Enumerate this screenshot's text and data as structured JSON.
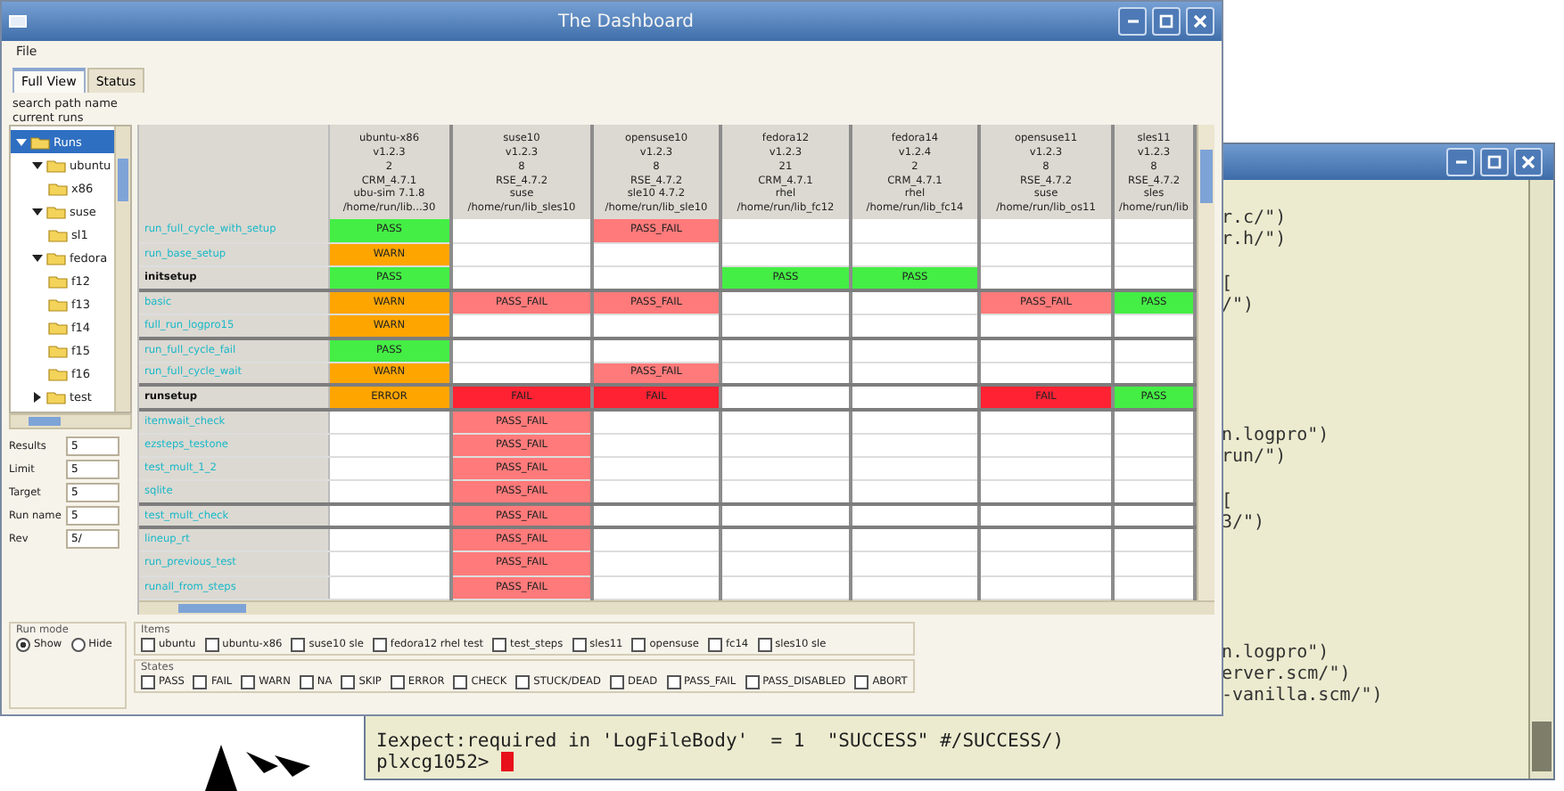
{
  "terminal": {
    "lines": [
      {
        "kind": "clipped",
        "text": "r.c/\")"
      },
      {
        "kind": "clipped",
        "text": "r.h/\")"
      },
      {
        "kind": "blank"
      },
      {
        "kind": "clipped",
        "text": "["
      },
      {
        "kind": "clipped",
        "text": "/\")"
      },
      {
        "kind": "blank"
      },
      {
        "kind": "blank"
      },
      {
        "kind": "blank"
      },
      {
        "kind": "blank"
      },
      {
        "kind": "blank"
      },
      {
        "kind": "clipped",
        "text": "n.logpro\")"
      },
      {
        "kind": "clipped",
        "text": "run/\")"
      },
      {
        "kind": "blank"
      },
      {
        "kind": "clipped",
        "text": "["
      },
      {
        "kind": "clipped",
        "text": "3/\")"
      },
      {
        "kind": "blank"
      },
      {
        "kind": "blank"
      },
      {
        "kind": "blank"
      },
      {
        "kind": "blank"
      },
      {
        "kind": "blank"
      },
      {
        "kind": "clipped",
        "text": "n.logpro\")"
      },
      {
        "kind": "clipped",
        "text": "erver.scm/\")"
      },
      {
        "kind": "clipped",
        "text": "-vanilla.scm/\")"
      },
      {
        "kind": "blank"
      },
      {
        "kind": "full",
        "text": "Iexpect:required in 'LogFileBody'  = 1  \"SUCCESS\" #/SUCCESS/)"
      },
      {
        "kind": "prompt",
        "text": "plxcg1052> "
      }
    ]
  },
  "dashboard": {
    "title": "The Dashboard",
    "menu": [
      "File"
    ],
    "tabs": [
      {
        "label": "Full View",
        "selected": true
      },
      {
        "label": "Status",
        "selected": false
      }
    ],
    "info": [
      "search path name",
      "current   runs"
    ],
    "tree": [
      {
        "label": "Runs",
        "selected": true,
        "expanded": true,
        "children": [
          {
            "label": "ubuntu",
            "selected": false,
            "expanded": true,
            "children": [
              {
                "label": "x86",
                "selected": false
              }
            ]
          },
          {
            "label": "suse",
            "selected": false,
            "expanded": true,
            "children": [
              {
                "label": "sl1",
                "selected": false
              }
            ]
          },
          {
            "label": "fedora",
            "selected": false,
            "expanded": true,
            "children": [
              {
                "label": "f12",
                "selected": false
              },
              {
                "label": "f13",
                "selected": false
              },
              {
                "label": "f14",
                "selected": false
              },
              {
                "label": "f15",
                "selected": false
              },
              {
                "label": "f16",
                "selected": false
              }
            ]
          },
          {
            "label": "test",
            "selected": false,
            "expanded": false
          }
        ]
      }
    ],
    "fields": [
      {
        "label": "Results",
        "value": "5"
      },
      {
        "label": "Limit",
        "value": "5"
      },
      {
        "label": "Target",
        "value": "5"
      },
      {
        "label": "Run name",
        "value": "5"
      },
      {
        "label": "Rev",
        "value": "5/"
      }
    ],
    "table": {
      "columns": [
        {
          "lines": [
            "ubuntu-x86",
            "v1.2.3",
            "2",
            "CRM_4.7.1",
            "ubu-sim 7.1.8",
            "/home/run/lib...30"
          ]
        },
        {
          "lines": [
            "suse10",
            "v1.2.3",
            "8",
            "RSE_4.7.2",
            "suse",
            "/home/run/lib_sles10"
          ]
        },
        {
          "lines": [
            "opensuse10",
            "v1.2.3",
            "8",
            "RSE_4.7.2",
            "sle10 4.7.2",
            "/home/run/lib_sle10"
          ]
        },
        {
          "lines": [
            "fedora12",
            "v1.2.3",
            "21",
            "CRM_4.7.1",
            "rhel",
            "/home/run/lib_fc12"
          ]
        },
        {
          "lines": [
            "fedora14",
            "v1.2.4",
            "2",
            "CRM_4.7.1",
            "rhel",
            "/home/run/lib_fc14"
          ]
        },
        {
          "lines": [
            "opensuse11",
            "v1.2.3",
            "8",
            "RSE_4.7.2",
            "suse",
            "/home/run/lib_os11"
          ]
        },
        {
          "lines": [
            "sles11",
            "v1.2.3",
            "8",
            "RSE_4.7.2",
            "sles",
            "/home/run/lib"
          ]
        }
      ],
      "rows": [
        {
          "label": "run_full_cycle_with_setup",
          "kind": "test",
          "cells": [
            {
              "kind": "pass",
              "text": "PASS"
            },
            {
              "kind": "empty"
            },
            {
              "kind": "pass_fail",
              "text": "PASS_FAIL"
            },
            {
              "kind": "empty"
            },
            {
              "kind": "empty"
            },
            {
              "kind": "empty"
            },
            {
              "kind": "empty"
            }
          ]
        },
        {
          "label": "run_base_setup",
          "kind": "test",
          "cells": [
            {
              "kind": "warn",
              "text": "WARN"
            },
            {
              "kind": "empty"
            },
            {
              "kind": "empty"
            },
            {
              "kind": "empty"
            },
            {
              "kind": "empty"
            },
            {
              "kind": "empty"
            },
            {
              "kind": "empty"
            }
          ]
        },
        {
          "label": "initsetup",
          "kind": "group",
          "cells": [
            {
              "kind": "pass",
              "text": "PASS"
            },
            {
              "kind": "empty"
            },
            {
              "kind": "empty"
            },
            {
              "kind": "pass",
              "text": "PASS"
            },
            {
              "kind": "pass",
              "text": "PASS"
            },
            {
              "kind": "empty"
            },
            {
              "kind": "empty"
            }
          ]
        },
        {
          "label": "basic",
          "kind": "test",
          "cells": [
            {
              "kind": "warn",
              "text": "WARN"
            },
            {
              "kind": "pass_fail",
              "text": "PASS_FAIL"
            },
            {
              "kind": "pass_fail",
              "text": "PASS_FAIL"
            },
            {
              "kind": "empty"
            },
            {
              "kind": "empty"
            },
            {
              "kind": "pass_fail",
              "text": "PASS_FAIL"
            },
            {
              "kind": "pass",
              "text": "PASS"
            }
          ]
        },
        {
          "label": "full_run_logpro15",
          "kind": "test",
          "cells": [
            {
              "kind": "warn",
              "text": "WARN"
            },
            {
              "kind": "empty"
            },
            {
              "kind": "empty"
            },
            {
              "kind": "empty"
            },
            {
              "kind": "empty"
            },
            {
              "kind": "empty"
            },
            {
              "kind": "empty"
            }
          ]
        },
        {
          "label": "run_full_cycle_fail",
          "kind": "test",
          "cells": [
            {
              "kind": "pass",
              "text": "PASS"
            },
            {
              "kind": "empty"
            },
            {
              "kind": "empty"
            },
            {
              "kind": "empty"
            },
            {
              "kind": "empty"
            },
            {
              "kind": "empty"
            },
            {
              "kind": "empty"
            }
          ]
        },
        {
          "label": "run_full_cycle_wait",
          "kind": "test",
          "cells": [
            {
              "kind": "warn",
              "text": "WARN"
            },
            {
              "kind": "empty"
            },
            {
              "kind": "pass_fail",
              "text": "PASS_FAIL"
            },
            {
              "kind": "empty"
            },
            {
              "kind": "empty"
            },
            {
              "kind": "empty"
            },
            {
              "kind": "empty"
            }
          ]
        },
        {
          "label": "runsetup",
          "kind": "group",
          "cells": [
            {
              "kind": "error",
              "text": "ERROR"
            },
            {
              "kind": "fail",
              "text": "FAIL"
            },
            {
              "kind": "fail",
              "text": "FAIL"
            },
            {
              "kind": "empty"
            },
            {
              "kind": "empty"
            },
            {
              "kind": "fail",
              "text": "FAIL"
            },
            {
              "kind": "pass",
              "text": "PASS"
            }
          ]
        },
        {
          "label": "itemwait_check",
          "kind": "test",
          "cells": [
            {
              "kind": "empty"
            },
            {
              "kind": "pass_fail",
              "text": "PASS_FAIL"
            },
            {
              "kind": "empty"
            },
            {
              "kind": "empty"
            },
            {
              "kind": "empty"
            },
            {
              "kind": "empty"
            },
            {
              "kind": "empty"
            }
          ]
        },
        {
          "label": "ezsteps_testone",
          "kind": "test",
          "cells": [
            {
              "kind": "empty"
            },
            {
              "kind": "pass_fail",
              "text": "PASS_FAIL"
            },
            {
              "kind": "empty"
            },
            {
              "kind": "empty"
            },
            {
              "kind": "empty"
            },
            {
              "kind": "empty"
            },
            {
              "kind": "empty"
            }
          ]
        },
        {
          "label": "test_mult_1_2",
          "kind": "test",
          "cells": [
            {
              "kind": "empty"
            },
            {
              "kind": "pass_fail",
              "text": "PASS_FAIL"
            },
            {
              "kind": "empty"
            },
            {
              "kind": "empty"
            },
            {
              "kind": "empty"
            },
            {
              "kind": "empty"
            },
            {
              "kind": "empty"
            }
          ]
        },
        {
          "label": "sqlite",
          "kind": "test",
          "cells": [
            {
              "kind": "empty"
            },
            {
              "kind": "pass_fail",
              "text": "PASS_FAIL"
            },
            {
              "kind": "empty"
            },
            {
              "kind": "empty"
            },
            {
              "kind": "empty"
            },
            {
              "kind": "empty"
            },
            {
              "kind": "empty"
            }
          ]
        },
        {
          "label": "test_mult_check",
          "kind": "test",
          "cells": [
            {
              "kind": "empty"
            },
            {
              "kind": "pass_fail",
              "text": "PASS_FAIL"
            },
            {
              "kind": "empty"
            },
            {
              "kind": "empty"
            },
            {
              "kind": "empty"
            },
            {
              "kind": "empty"
            },
            {
              "kind": "empty"
            }
          ]
        },
        {
          "label": "lineup_rt",
          "kind": "test",
          "cells": [
            {
              "kind": "empty"
            },
            {
              "kind": "pass_fail",
              "text": "PASS_FAIL"
            },
            {
              "kind": "empty"
            },
            {
              "kind": "empty"
            },
            {
              "kind": "empty"
            },
            {
              "kind": "empty"
            },
            {
              "kind": "empty"
            }
          ]
        },
        {
          "label": "run_previous_test",
          "kind": "test",
          "cells": [
            {
              "kind": "empty"
            },
            {
              "kind": "pass_fail",
              "text": "PASS_FAIL"
            },
            {
              "kind": "empty"
            },
            {
              "kind": "empty"
            },
            {
              "kind": "empty"
            },
            {
              "kind": "empty"
            },
            {
              "kind": "empty"
            }
          ]
        },
        {
          "label": "runall_from_steps",
          "kind": "test",
          "cells": [
            {
              "kind": "empty"
            },
            {
              "kind": "pass_fail",
              "text": "PASS_FAIL"
            },
            {
              "kind": "empty"
            },
            {
              "kind": "empty"
            },
            {
              "kind": "empty"
            },
            {
              "kind": "empty"
            },
            {
              "kind": "empty"
            }
          ]
        }
      ]
    },
    "run_mode": {
      "title": "Run mode",
      "options": [
        {
          "label": "Show",
          "selected": true
        },
        {
          "label": "Hide",
          "selected": false
        }
      ]
    },
    "items": {
      "title": "Items",
      "options": [
        {
          "label": "ubuntu",
          "checked": false
        },
        {
          "label": "ubuntu-x86",
          "checked": false
        },
        {
          "label": "suse10 sle",
          "checked": false
        },
        {
          "label": "fedora12 rhel test",
          "checked": false
        },
        {
          "label": "test_steps",
          "checked": false
        },
        {
          "label": "sles11",
          "checked": false
        },
        {
          "label": "opensuse",
          "checked": false
        },
        {
          "label": "fc14",
          "checked": false
        },
        {
          "label": "sles10 sle",
          "checked": false
        }
      ]
    },
    "states": {
      "title": "States",
      "options": [
        {
          "label": "PASS",
          "checked": false
        },
        {
          "label": "FAIL",
          "checked": false
        },
        {
          "label": "WARN",
          "checked": false
        },
        {
          "label": "NA",
          "checked": false
        },
        {
          "label": "SKIP",
          "checked": false
        },
        {
          "label": "ERROR",
          "checked": false
        },
        {
          "label": "CHECK",
          "checked": false
        },
        {
          "label": "STUCK/DEAD",
          "checked": false
        },
        {
          "label": "DEAD",
          "checked": false
        },
        {
          "label": "PASS_FAIL",
          "checked": false
        },
        {
          "label": "PASS_DISABLED",
          "checked": false
        },
        {
          "label": "ABORT",
          "checked": false
        }
      ]
    }
  }
}
